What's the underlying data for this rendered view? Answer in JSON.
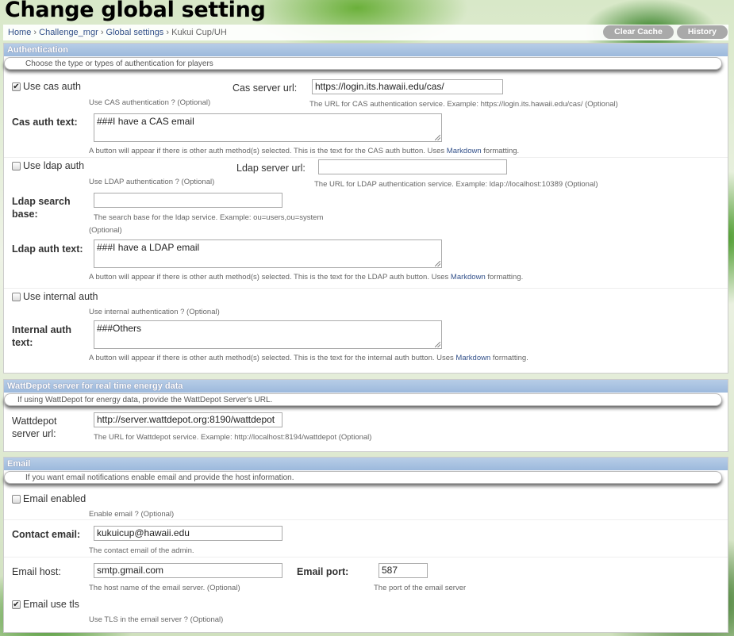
{
  "page": {
    "title": "Change global setting"
  },
  "breadcrumb": {
    "home": "Home",
    "sep1": "›",
    "app": "Challenge_mgr",
    "sep2": "›",
    "model": "Global settings",
    "sep3": "›",
    "current": "Kukui Cup/UH"
  },
  "tools": {
    "clear_cache": "Clear Cache",
    "history": "History"
  },
  "auth": {
    "heading": "Authentication",
    "description": "Choose the type or types of authentication for players",
    "cas": {
      "checkbox_label": "Use cas auth",
      "checked": true,
      "checkbox_help": "Use CAS authentication ? (Optional)",
      "server_label": "Cas server url:",
      "server_value": "https://login.its.hawaii.edu/cas/",
      "server_help": "The URL for CAS authentication service. Example: https://login.its.hawaii.edu/cas/ (Optional)",
      "text_label": "Cas auth text:",
      "text_value": "###I have a CAS email",
      "text_help_before": "A button will appear if there is other auth method(s) selected. This is the text for the CAS auth button. Uses",
      "markdown_link": "Markdown",
      "text_help_after": "formatting."
    },
    "ldap": {
      "checkbox_label": "Use ldap auth",
      "checked": false,
      "checkbox_help": "Use LDAP authentication ? (Optional)",
      "server_label": "Ldap server url:",
      "server_value": "",
      "server_help": "The URL for LDAP authentication service. Example: ldap://localhost:10389 (Optional)",
      "search_label_1": "Ldap search",
      "search_label_2": "base:",
      "search_value": "",
      "search_help": "The search base for the ldap service. Example: ou=users,ou=system",
      "search_optional": "(Optional)",
      "text_label": "Ldap auth text:",
      "text_value": "###I have a LDAP email",
      "text_help_before": "A button will appear if there is other auth method(s) selected. This is the text for the LDAP auth button. Uses",
      "markdown_link": "Markdown",
      "text_help_after": "formatting."
    },
    "internal": {
      "checkbox_label": "Use internal auth",
      "checked": false,
      "checkbox_help": "Use internal authentication ? (Optional)",
      "text_label_1": "Internal auth",
      "text_label_2": "text:",
      "text_value": "###Others",
      "text_help_before": "A button will appear if there is other auth method(s) selected. This is the text for the internal auth button. Uses",
      "markdown_link": "Markdown",
      "text_help_after": "formatting."
    }
  },
  "wattdepot": {
    "heading": "WattDepot server for real time energy data",
    "description": "If using WattDepot for energy data, provide the WattDepot Server's URL.",
    "label_1": "Wattdepot",
    "label_2": "server url:",
    "value": "http://server.wattdepot.org:8190/wattdepot",
    "help": "The URL for Wattdepot service. Example: http://localhost:8194/wattdepot (Optional)"
  },
  "email": {
    "heading": "Email",
    "description": "If you want email notifications enable email and provide the host information.",
    "enabled_label": "Email enabled",
    "enabled_checked": false,
    "enabled_help": "Enable email ? (Optional)",
    "contact_label": "Contact email:",
    "contact_value": "kukuicup@hawaii.edu",
    "contact_help": "The contact email of the admin.",
    "host_label": "Email host:",
    "host_value": "smtp.gmail.com",
    "host_help": "The host name of the email server. (Optional)",
    "port_label": "Email port:",
    "port_value": "587",
    "port_help": "The port of the email server",
    "tls_label": "Email use tls",
    "tls_checked": true,
    "tls_help": "Use TLS in the email server ? (Optional)"
  },
  "glyphs": {
    "check": "✔",
    "none": ""
  }
}
